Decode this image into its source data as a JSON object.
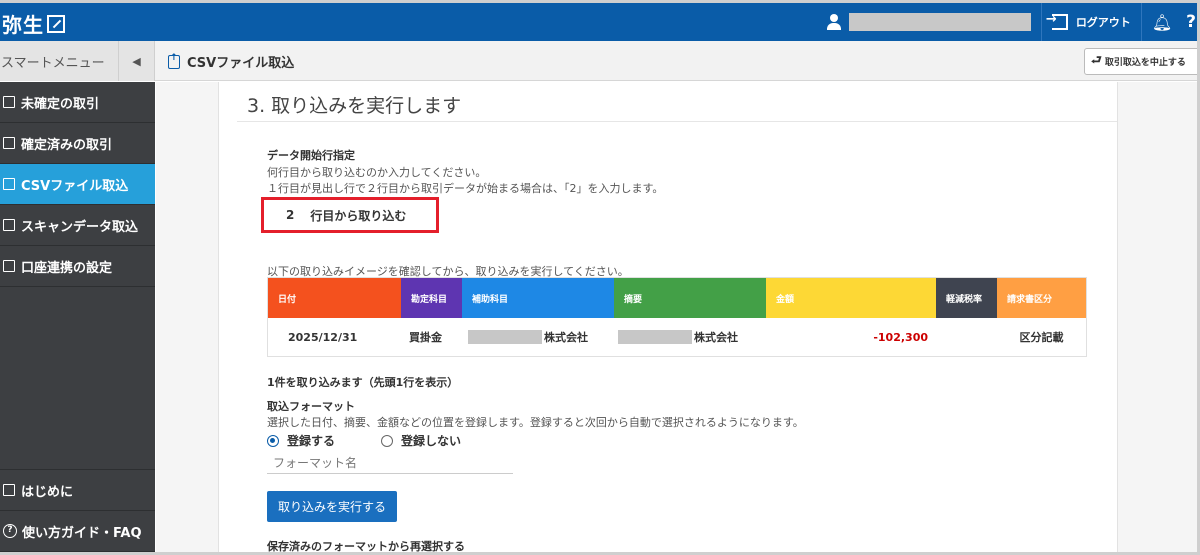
{
  "app": {
    "logo_text": "弥生",
    "logout_label": "ログアウト"
  },
  "subheader": {
    "smart_menu_label": "スマートメニュー",
    "page_title": "CSVファイル取込",
    "stop_button_label": "取引取込を中止する"
  },
  "sidebar": {
    "items": [
      {
        "label": "未確定の取引",
        "icon": "list-icon"
      },
      {
        "label": "確定済みの取引",
        "icon": "check-list-icon"
      },
      {
        "label": "CSVファイル取込",
        "icon": "file-upload-icon",
        "active": true
      },
      {
        "label": "スキャンデータ取込",
        "icon": "printer-icon"
      },
      {
        "label": "口座連携の設定",
        "icon": "bank-icon"
      }
    ],
    "bottom_items": [
      {
        "label": "はじめに",
        "icon": "book-icon"
      },
      {
        "label": "使い方ガイド・FAQ",
        "icon": "help-circle-icon"
      }
    ]
  },
  "main": {
    "step_title": "3. 取り込みを実行します",
    "data_start": {
      "heading": "データ開始行指定",
      "desc1": "何行目から取り込むのか入力してください。",
      "desc2": "１行目が見出し行で２行目から取引データが始まる場合は、「2」を入力します。",
      "value": "2",
      "suffix": "行目から取り込む"
    },
    "preview": {
      "caption": "以下の取り込みイメージを確認してから、取り込みを実行してください。",
      "columns": [
        {
          "label": "日付",
          "color": "#f4511e"
        },
        {
          "label": "勘定科目",
          "color": "#5e35b1"
        },
        {
          "label": "補助科目",
          "color": "#1e88e5"
        },
        {
          "label": "摘要",
          "color": "#43a047"
        },
        {
          "label": "金額",
          "color": "#fdd835"
        },
        {
          "label": "軽減税率",
          "color": "#3f4450"
        },
        {
          "label": "請求書区分",
          "color": "#ff9f43"
        }
      ],
      "row": {
        "date": "2025/12/31",
        "account": "買掛金",
        "sub_account": "株式会社",
        "memo": "株式会社",
        "amount": "-102,300",
        "amount_color": "#cc0000",
        "reduced_tax": "",
        "invoice_type": "区分記載"
      }
    },
    "count_text": "1件を取り込みます（先頭1行を表示）",
    "format": {
      "heading": "取込フォーマット",
      "desc": "選択した日付、摘要、金額などの位置を登録します。登録すると次回から自動で選択されるようになります。",
      "options": [
        "登録する",
        "登録しない"
      ],
      "selected": "登録する",
      "name_placeholder": "フォーマット名"
    },
    "execute_label": "取り込みを実行する",
    "reselect_heading": "保存済みのフォーマットから再選択する"
  }
}
